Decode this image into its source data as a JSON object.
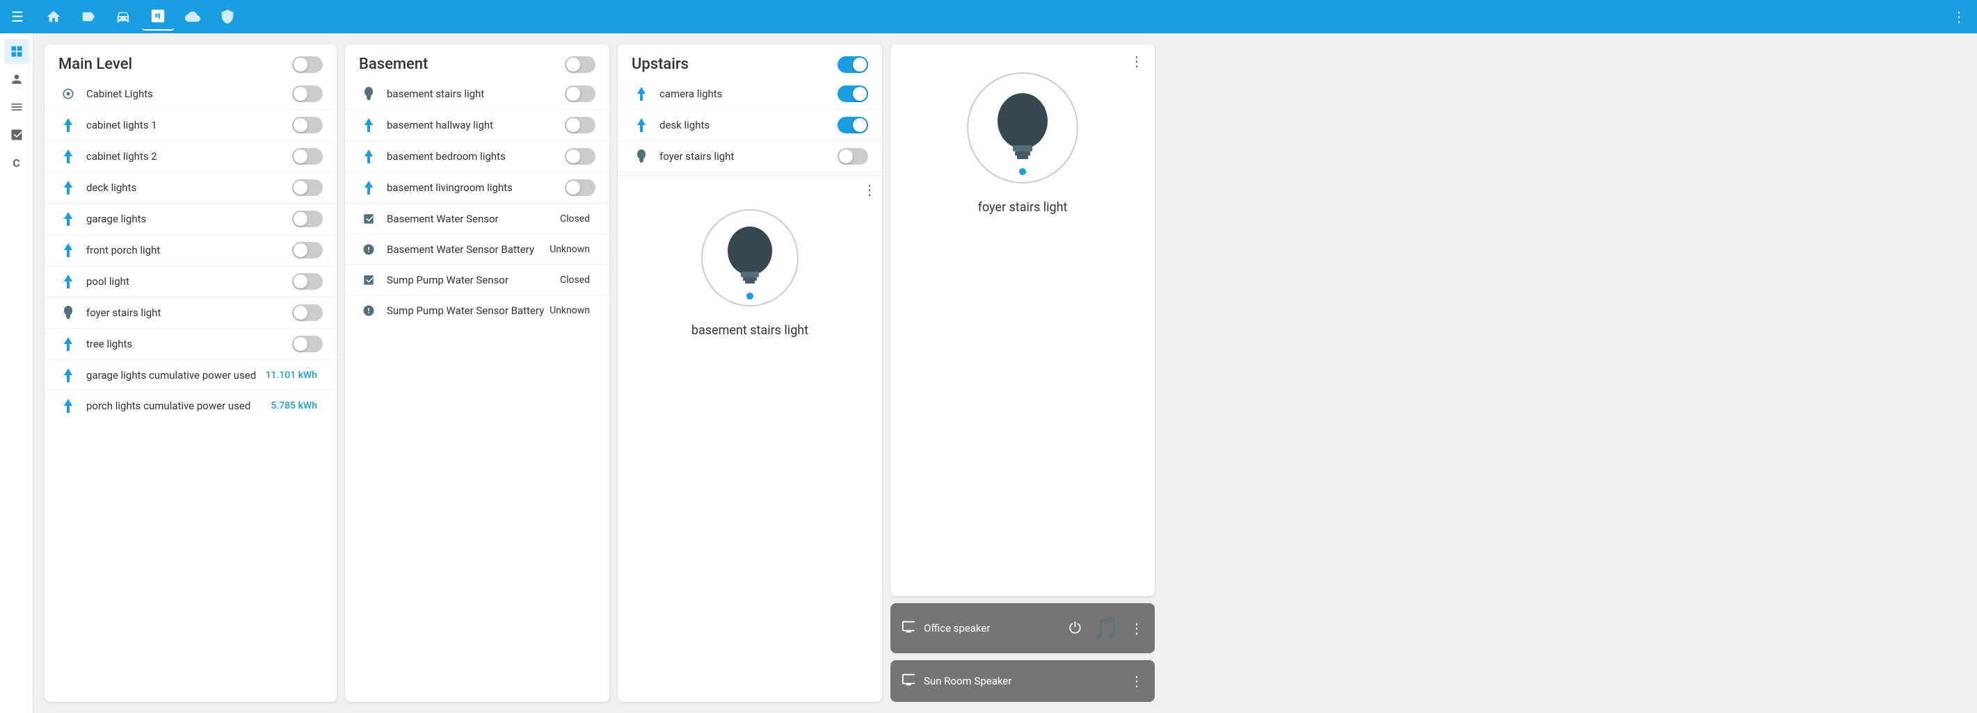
{
  "topNav": {
    "menuIcon": "☰",
    "icons": [
      {
        "id": "home",
        "symbol": "⌂",
        "active": false
      },
      {
        "id": "tag",
        "symbol": "🏷",
        "active": false
      },
      {
        "id": "car",
        "symbol": "🚗",
        "active": false
      },
      {
        "id": "nfc",
        "symbol": "N",
        "active": true
      },
      {
        "id": "cloud",
        "symbol": "☁",
        "active": false
      },
      {
        "id": "shield",
        "symbol": "🛡",
        "active": false
      }
    ],
    "moreIcon": "⋮"
  },
  "sidebar": {
    "icons": [
      {
        "id": "grid",
        "symbol": "⊞",
        "active": true
      },
      {
        "id": "person",
        "symbol": "👤",
        "active": false
      },
      {
        "id": "list",
        "symbol": "≡",
        "active": false
      },
      {
        "id": "chart",
        "symbol": "📊",
        "active": false
      },
      {
        "id": "c-icon",
        "symbol": "C",
        "active": false
      }
    ]
  },
  "mainLevel": {
    "title": "Main Level",
    "toggleOn": false,
    "devices": [
      {
        "id": "cabinet-lights",
        "name": "Cabinet Lights",
        "icon": "◎",
        "type": "toggle",
        "on": false
      },
      {
        "id": "cabinet-lights-1",
        "name": "cabinet lights 1",
        "icon": "⚡",
        "type": "toggle",
        "on": false
      },
      {
        "id": "cabinet-lights-2",
        "name": "cabinet lights 2",
        "icon": "⚡",
        "type": "toggle",
        "on": false
      },
      {
        "id": "deck-lights",
        "name": "deck lights",
        "icon": "⚡",
        "type": "toggle",
        "on": false
      },
      {
        "id": "garage-lights",
        "name": "garage lights",
        "icon": "⚡",
        "type": "toggle",
        "on": false
      },
      {
        "id": "front-porch-light",
        "name": "front porch light",
        "icon": "⚡",
        "type": "toggle",
        "on": false
      },
      {
        "id": "pool-light",
        "name": "pool light",
        "icon": "⚡",
        "type": "toggle",
        "on": false
      },
      {
        "id": "foyer-stairs-light",
        "name": "foyer stairs light",
        "icon": "💡",
        "type": "toggle",
        "on": false
      },
      {
        "id": "tree-lights",
        "name": "tree lights",
        "icon": "⚡",
        "type": "toggle",
        "on": false
      },
      {
        "id": "garage-power",
        "name": "garage lights cumulative power used",
        "icon": "⚡",
        "type": "value",
        "value": "11.101 kWh",
        "valueClass": "blue"
      },
      {
        "id": "porch-power",
        "name": "porch lights cumulative power used",
        "icon": "⚡",
        "type": "value",
        "value": "5.785 kWh",
        "valueClass": "blue"
      }
    ]
  },
  "basement": {
    "title": "Basement",
    "toggleOn": false,
    "devices": [
      {
        "id": "basement-stairs-light",
        "name": "basement stairs light",
        "icon": "💡",
        "type": "toggle",
        "on": false
      },
      {
        "id": "basement-hallway-light",
        "name": "basement hallway light",
        "icon": "⚡",
        "type": "toggle",
        "on": false
      },
      {
        "id": "basement-bedroom-lights",
        "name": "basement bedroom lights",
        "icon": "⚡",
        "type": "toggle",
        "on": false
      },
      {
        "id": "basement-livingroom-lights",
        "name": "basement livingroom lights",
        "icon": "⚡",
        "type": "toggle",
        "on": false
      },
      {
        "id": "basement-water-sensor",
        "name": "Basement Water Sensor",
        "icon": "🚪",
        "type": "status",
        "value": "Closed"
      },
      {
        "id": "basement-water-sensor-battery",
        "name": "Basement Water Sensor Battery",
        "icon": "❓",
        "type": "status",
        "value": "Unknown"
      },
      {
        "id": "sump-pump-water-sensor",
        "name": "Sump Pump Water Sensor",
        "icon": "🚪",
        "type": "status",
        "value": "Closed"
      },
      {
        "id": "sump-pump-water-sensor-battery",
        "name": "Sump Pump Water Sensor Battery",
        "icon": "❓",
        "type": "status",
        "value": "Unknown"
      }
    ]
  },
  "upstairs": {
    "title": "Upstairs",
    "toggleOn": true,
    "devices": [
      {
        "id": "camera-lights",
        "name": "camera lights",
        "icon": "⚡",
        "type": "toggle",
        "on": true
      },
      {
        "id": "desk-lights",
        "name": "desk lights",
        "icon": "⚡",
        "type": "toggle",
        "on": true
      },
      {
        "id": "foyer-stairs-light-up",
        "name": "foyer stairs light",
        "icon": "💡",
        "type": "toggle",
        "on": false
      }
    ]
  },
  "basementDetail": {
    "name": "basement stairs light",
    "moreIcon": "⋮"
  },
  "foyerDetail": {
    "name": "foyer stairs light",
    "moreIcon": "⋮"
  },
  "officeSpeaker": {
    "name": "Office speaker",
    "icon": "📺",
    "moreIcon": "⋮",
    "powerIcon": "⏻",
    "musicIcon": "🎵"
  },
  "sunRoomSpeaker": {
    "name": "Sun Room Speaker",
    "icon": "📺",
    "moreIcon": "⋮"
  }
}
